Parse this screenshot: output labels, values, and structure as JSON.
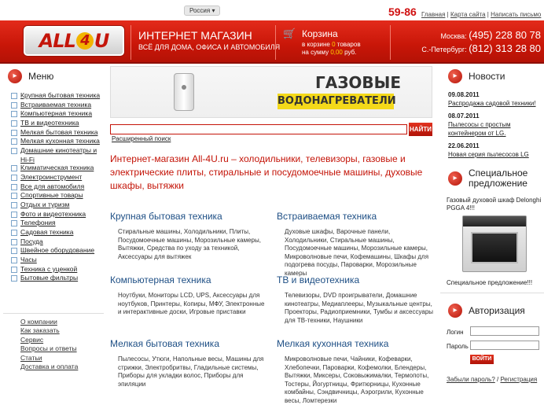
{
  "topbar": {
    "region": "Россия ▾",
    "phone_code": "59-86",
    "links": [
      "Главная",
      "Карта сайта",
      "Написать письмо"
    ],
    "sep": " | "
  },
  "header": {
    "logo_main": "ALL",
    "logo_num": "4",
    "logo_tail": "U",
    "title": "ИНТЕРНЕТ МАГАЗИН",
    "subtitle": "ВСЁ ДЛЯ ДОМА, ОФИСА И АВТОМОБИЛЯ",
    "cart_title": "Корзина",
    "cart_line1a": "в корзине ",
    "cart_count": "0",
    "cart_line1b": " товаров",
    "cart_line2a": "на сумму ",
    "cart_sum": "0,00",
    "cart_line2b": " руб.",
    "moscow_label": "Москва:",
    "moscow_phone": "(495) 228 80 78",
    "spb_label": "С.-Петербург:",
    "spb_phone": "(812) 313 28 80"
  },
  "menu": {
    "title": "Меню",
    "items": [
      "Крупная бытовая техника",
      "Встраиваемая техника",
      "Компьютерная техника",
      "ТВ и видеотехника",
      "Мелкая бытовая техника",
      "Мелкая кухонная техника",
      "Домашние кинотеатры и Hi-Fi",
      "Климатическая техника",
      "Электроинструмент",
      "Все для автомобиля",
      "Спортивные товары",
      "Отдых и туризм",
      "Фото и видеотехника",
      "Телефония",
      "Садовая техника",
      "Посуда",
      "Швейное оборудование",
      "Часы",
      "Техника с уценкой",
      "Бытовые фильтры"
    ]
  },
  "sidelinks": [
    "О компании",
    "Как заказать",
    "Сервис",
    "Вопросы и ответы",
    "Статьи",
    "Доставка и оплата"
  ],
  "banner": {
    "line1": "ГАЗОВЫЕ",
    "line2": "ВОДОНАГРЕВАТЕЛИ"
  },
  "search": {
    "button": "НАЙТИ",
    "extended": "Расширенный поиск"
  },
  "intro": "Интернет-магазин All-4U.ru – холодильники, телевизоры, газовые и электрические плиты, стиральные и посудомоечные машины, духовые шкафы, вытяжки",
  "categories": [
    {
      "title": "Крупная бытовая техника",
      "links": "Стиральные машины, Холодильники, Плиты, Посудомоечные машины, Морозильные камеры, Вытяжки, Средства по уходу за техникой, Аксессуары для вытяжек"
    },
    {
      "title": "Встраиваемая техника",
      "links": "Духовые шкафы, Варочные панели, Холодильники, Стиральные машины, Посудомоечные машины, Морозильные камеры, Микроволновые печи, Кофемашины, Шкафы для подогрева посуды, Пароварки, Морозильные камеры"
    },
    {
      "title": "Компьютерная техника",
      "links": "Ноутбуки, Мониторы LCD, UPS, Аксессуары для ноутбуков, Принтеры, Копиры, МФУ, Электронные и интерактивные доски, Игровые приставки"
    },
    {
      "title": "ТВ и видеотехника",
      "links": "Телевизоры, DVD проигрыватели, Домашние кинотеатры, Медиаплееры, Музыкальные центры, Проекторы, Радиоприемники, Тумбы и аксессуары для ТВ-техники, Наушники"
    },
    {
      "title": "Мелкая бытовая техника",
      "links": "Пылесосы, Утюги, Напольные весы, Машины для стрижки, Электробритвы, Гладильные системы, Приборы для укладки волос, Приборы для эпиляции"
    },
    {
      "title": "Мелкая кухонная техника",
      "links": "Микроволновые печи, Чайники, Кофеварки, Хлебопечки, Пароварки, Кофемолки, Блендеры, Вытяжки, Миксеры, Соковыжималки, Термопоты, Тостеры, Йогуртницы, Фритюрницы, Кухонные комбайны, Сэндвичницы, Аэрогрили, Кухонные весы, Ломтерезки"
    }
  ],
  "news": {
    "title": "Новости",
    "items": [
      {
        "date": "09.08.2011",
        "text": "Распродажа садовой техники!"
      },
      {
        "date": "08.07.2011",
        "text": "Пылесосы с простым контейнером от LG."
      },
      {
        "date": "22.06.2011",
        "text": "Новая серия пылесосов LG"
      }
    ]
  },
  "special": {
    "title": "Специальное предложение",
    "text": "Газовый духовой шкаф Delonghi PGGA 4!!!",
    "note": "Специальное предложение!!!"
  },
  "auth": {
    "title": "Авторизация",
    "login": "Логин",
    "password": "Пароль",
    "button": "ВОЙТИ",
    "forgot": "Забыли пароль?",
    "register": "Регистрация",
    "sep": " / "
  }
}
